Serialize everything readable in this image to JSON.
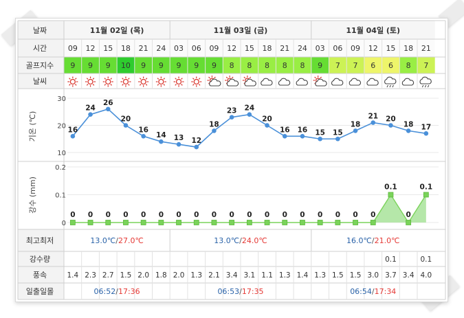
{
  "labels": {
    "date": "날짜",
    "time": "시간",
    "golf_index": "골프지수",
    "weather": "날씨",
    "temp_axis": "기온 (℃)",
    "rain_axis": "강수 (mm)",
    "minmax": "최고최저",
    "precip": "강수량",
    "wind": "풍속",
    "sun": "일출일몰"
  },
  "days": [
    {
      "label": "11월 02일 (목)",
      "min": "13.0℃",
      "max": "27.0℃",
      "sunrise": "06:52",
      "sunset": "17:36"
    },
    {
      "label": "11월 03일 (금)",
      "min": "13.0℃",
      "max": "24.0℃",
      "sunrise": "06:53",
      "sunset": "17:35"
    },
    {
      "label": "11월 04일 (토)",
      "min": "16.0℃",
      "max": "21.0℃",
      "sunrise": "06:54",
      "sunset": "17:34"
    }
  ],
  "hours": [
    "09",
    "12",
    "15",
    "18",
    "21",
    "24",
    "03",
    "06",
    "09",
    "12",
    "15",
    "18",
    "21",
    "24",
    "03",
    "06",
    "09",
    "12",
    "15",
    "18",
    "21"
  ],
  "golf_index": [
    "9",
    "9",
    "9",
    "10",
    "9",
    "9",
    "9",
    "9",
    "9",
    "8",
    "8",
    "8",
    "8",
    "8",
    "9",
    "7",
    "7",
    "6",
    "6",
    "8",
    "7"
  ],
  "weather_icons": [
    "sun-icon",
    "sun-icon",
    "sun-icon",
    "sun-icon",
    "sun-icon",
    "sun-icon",
    "sun-icon",
    "sun-icon",
    "sun-cloud-icon",
    "sun-cloud-icon",
    "sun-cloud-icon",
    "cloud-icon",
    "cloud-icon",
    "cloud-icon",
    "sun-cloud-icon",
    "cloud-icon",
    "cloud-icon",
    "cloud-icon",
    "rain-cloud-icon",
    "cloud-icon",
    "rain-cloud-icon"
  ],
  "precip_amounts": [
    "",
    "",
    "",
    "",
    "",
    "",
    "",
    "",
    "",
    "",
    "",
    "",
    "",
    "",
    "",
    "",
    "",
    "",
    "0.1",
    "",
    "0.1"
  ],
  "wind_speeds": [
    "1.4",
    "2.3",
    "2.7",
    "1.5",
    "2.0",
    "1.8",
    "2.0",
    "1.3",
    "2.1",
    "3.4",
    "3.1",
    "1.1",
    "1.3",
    "1.4",
    "1.3",
    "1.5",
    "1.5",
    "3.0",
    "3.7",
    "3.4",
    "4.0"
  ],
  "colors": {
    "temp_line": "#4a90d9",
    "rain_fill": "#a8e39a",
    "rain_point": "#7ad35a",
    "max_text": "#e53935",
    "min_text": "#2962a8",
    "sun_icon": "#d9342b",
    "golf_10": "#2ecc2e",
    "golf_9": "#66dd33",
    "golf_8": "#99ee44",
    "golf_7": "#ccf255",
    "golf_6": "#eef56a"
  },
  "chart_data": [
    {
      "type": "line",
      "ylabel": "기온 (℃)",
      "ylim": [
        10,
        30
      ],
      "yticks": [
        10,
        20,
        30
      ],
      "x": [
        "09",
        "12",
        "15",
        "18",
        "21",
        "24",
        "03",
        "06",
        "09",
        "12",
        "15",
        "18",
        "21",
        "24",
        "03",
        "06",
        "09",
        "12",
        "15",
        "18",
        "21"
      ],
      "series": [
        {
          "values": [
            16,
            24,
            26,
            20,
            16,
            14,
            13,
            12,
            18,
            23,
            24,
            20,
            16,
            16,
            15,
            15,
            18,
            21,
            20,
            18,
            17
          ]
        }
      ],
      "grid": true
    },
    {
      "type": "area",
      "ylabel": "강수 (mm)",
      "ylim": [
        0,
        0.2
      ],
      "yticks": [
        0,
        0.1,
        0.2
      ],
      "x": [
        "09",
        "12",
        "15",
        "18",
        "21",
        "24",
        "03",
        "06",
        "09",
        "12",
        "15",
        "18",
        "21",
        "24",
        "03",
        "06",
        "09",
        "12",
        "15",
        "18",
        "21"
      ],
      "series": [
        {
          "values": [
            0,
            0,
            0,
            0,
            0,
            0,
            0,
            0,
            0,
            0,
            0,
            0,
            0,
            0,
            0,
            0,
            0,
            0,
            0.1,
            0,
            0.1
          ]
        }
      ],
      "grid": true
    }
  ]
}
